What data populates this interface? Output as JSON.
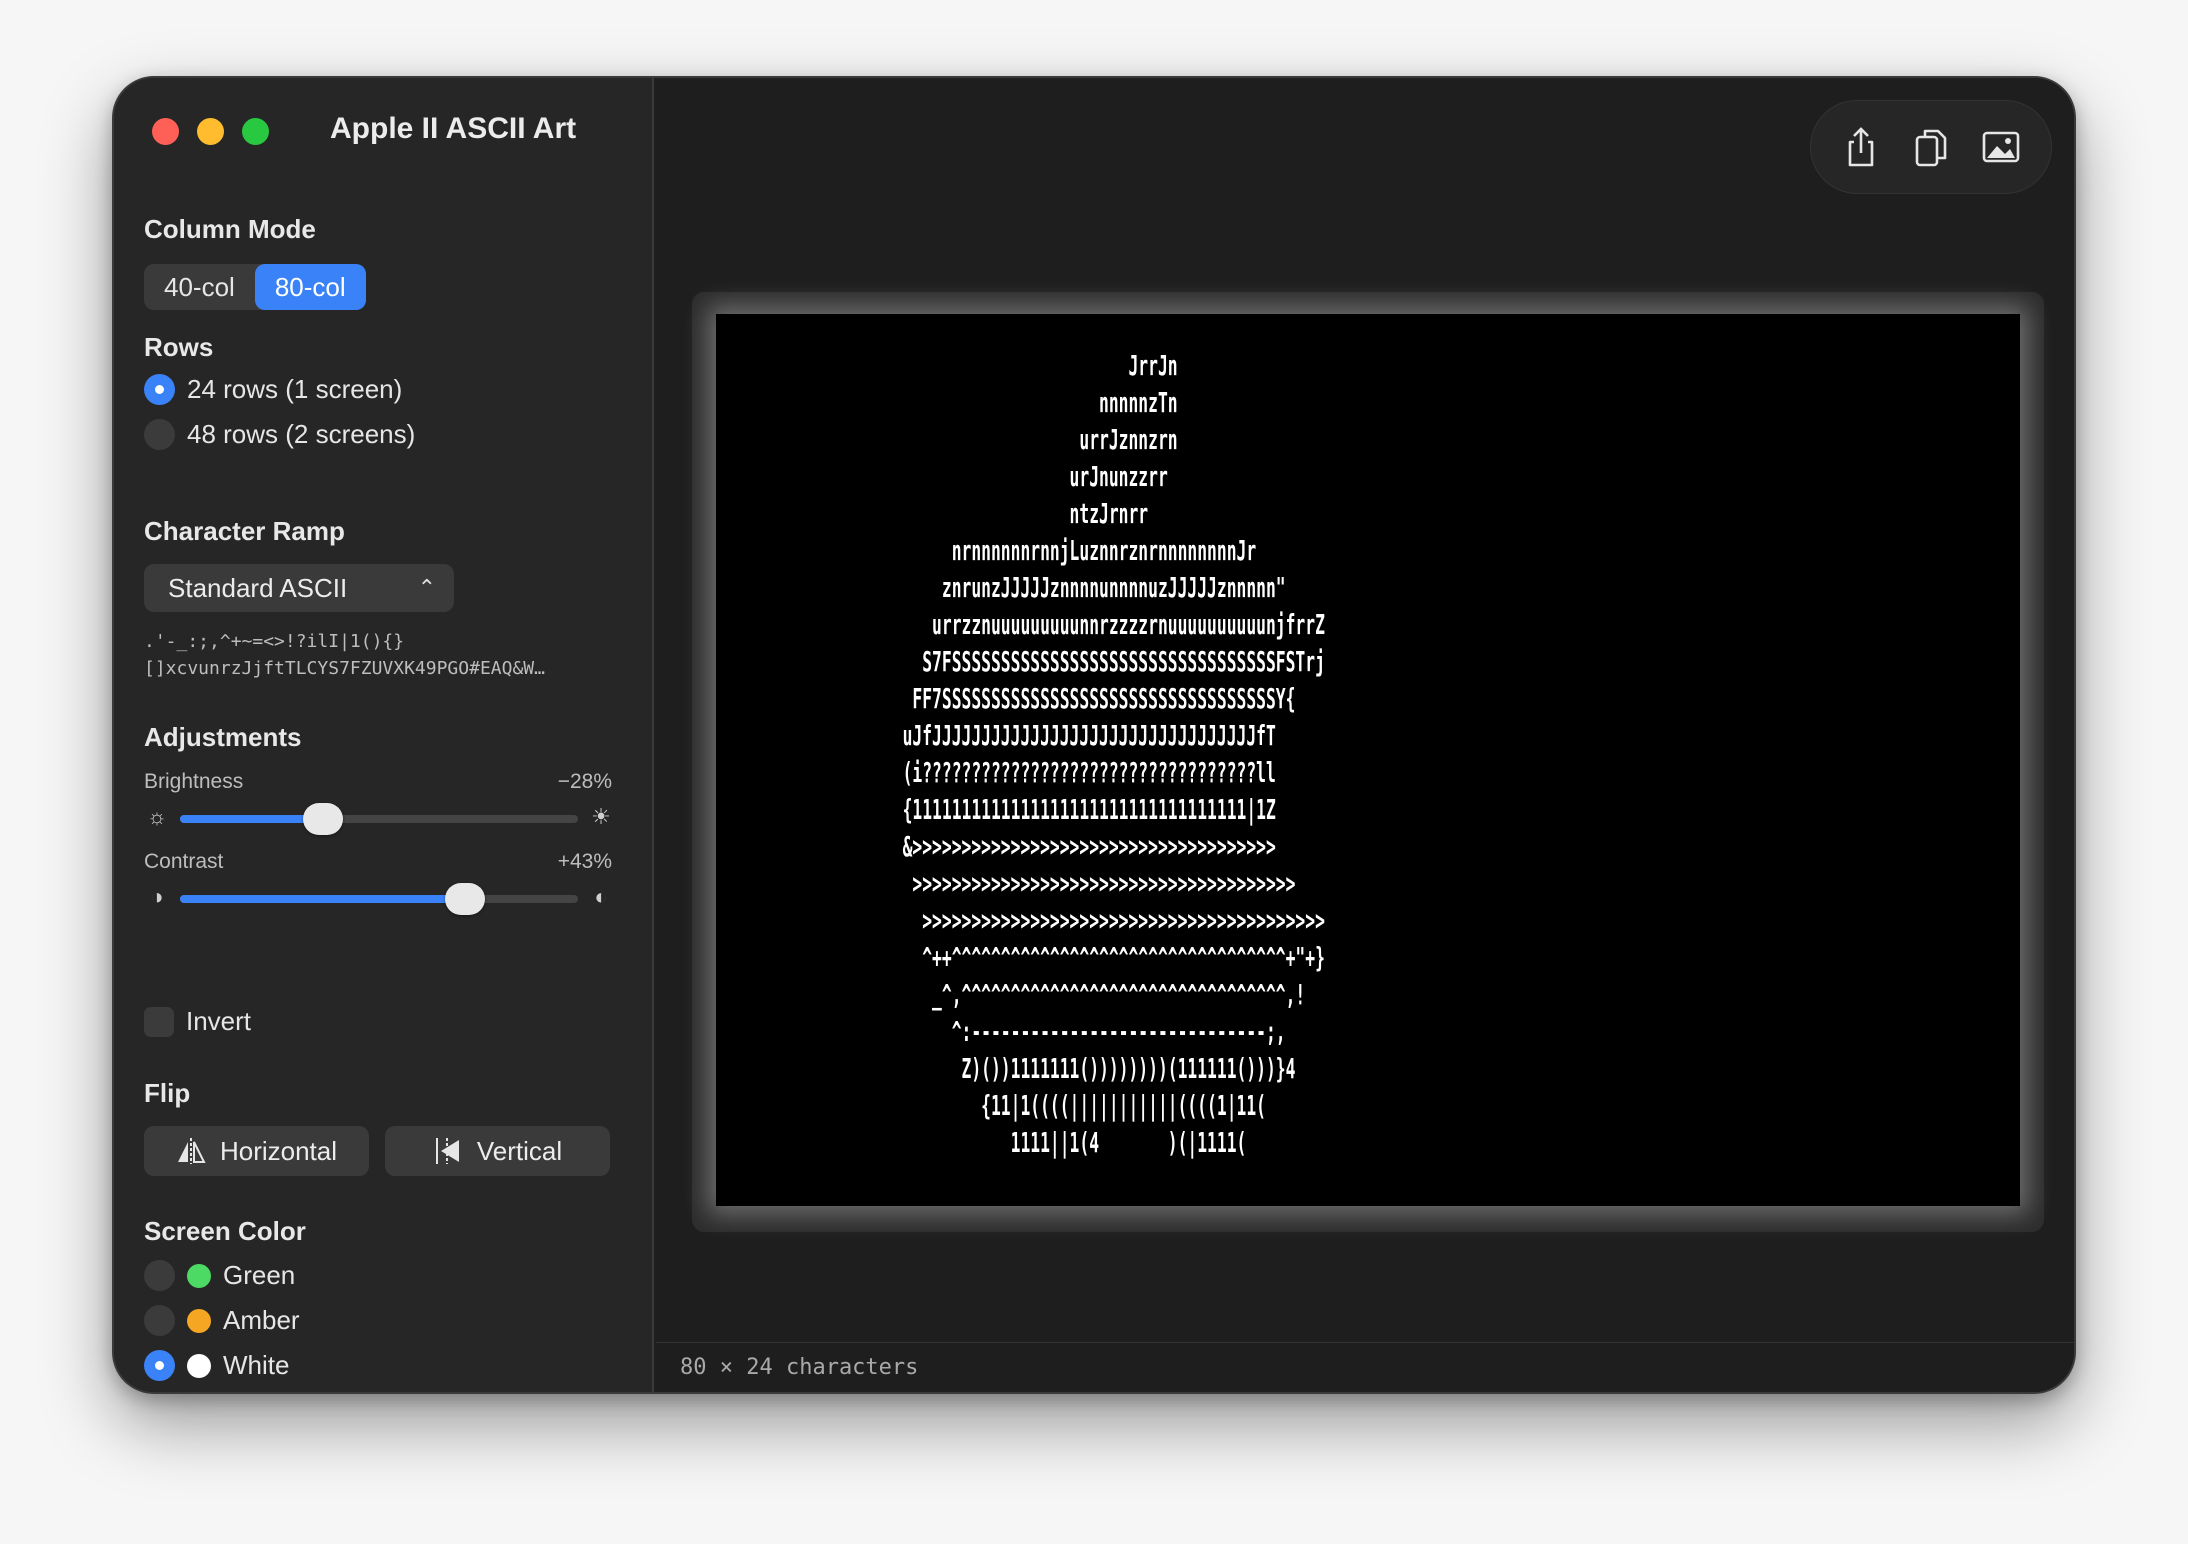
{
  "app": {
    "title": "Apple II ASCII Art"
  },
  "column_mode": {
    "title": "Column Mode",
    "options": [
      "40-col",
      "80-col"
    ],
    "selected": "80-col"
  },
  "rows": {
    "title": "Rows",
    "options": [
      "24 rows (1 screen)",
      "48 rows (2 screens)"
    ],
    "selected": "24 rows (1 screen)"
  },
  "character_ramp": {
    "title": "Character Ramp",
    "selected": "Standard ASCII",
    "preview_line1": " .'-_:;,^+~=<>!?ilI|1(){}",
    "preview_line2": "[]xcvunrzJjftTLCYS7FZUVXK49PGO#EAQ&W…"
  },
  "adjustments": {
    "title": "Adjustments",
    "brightness": {
      "label": "Brightness",
      "value_text": "−28%",
      "fraction": 0.36
    },
    "contrast": {
      "label": "Contrast",
      "value_text": "+43%",
      "fraction": 0.715
    },
    "invert": {
      "label": "Invert",
      "checked": false
    }
  },
  "flip": {
    "title": "Flip",
    "horizontal_label": "Horizontal",
    "vertical_label": "Vertical"
  },
  "screen_color": {
    "title": "Screen Color",
    "options": [
      {
        "label": "Green",
        "color": "#4cd964"
      },
      {
        "label": "Amber",
        "color": "#f5a623"
      },
      {
        "label": "White",
        "color": "#ffffff"
      }
    ],
    "selected": "White"
  },
  "toolbar": {
    "icons": [
      "share-icon",
      "copy-icon",
      "image-icon"
    ]
  },
  "preview": {
    "lines": [
      "                                          JrrJn",
      "                                       nnnnnzTn",
      "                                     urrJznnzrn",
      "                                    urJnunzzrr",
      "                                    ntzJrnrr",
      "                        nrnnnnnnrnnjLuznnrznrnnnnnnnnJr",
      "                       znrunzJJJJJznnnnunnnnuzJJJJJznnnnn\"",
      "                      urrzznuuuuuuuuunnrzzzzrnuuuuuuuuuunjfrrZ",
      "                     S7FSSSSSSSSSSSSSSSSSSSSSSSSSSSSSSSSSFSTrj",
      "                    FF7SSSSSSSSSSSSSSSSSSSSSSSSSSSSSSSSSSY{",
      "                   uJfJJJJJJJJJJJJJJJJJJJJJJJJJJJJJJJJJfT",
      "                   (i??????????????????????????????????ll",
      "                   {1111111111111111111111111111111111|1Z",
      "                   &>>>>>>>>>>>>>>>>>>>>>>>>>>>>>>>>>>>>>",
      "                    >>>>>>>>>>>>>>>>>>>>>>>>>>>>>>>>>>>>>>>",
      "                     >>>>>>>>>>>>>>>>>>>>>>>>>>>>>>>>>>>>>>>>>",
      "                     ^++^^^^^^^^^^^^^^^^^^^^^^^^^^^^^^^^^^+\"+}",
      "                      _^,^^^^^^^^^^^^^^^^^^^^^^^^^^^^^^^^^,!",
      "                        ^:------------------------------;,",
      "                         Z)())1111111())))))))(111111()))}4",
      "                           {11|1((((|||||||||||((((1|11(",
      "                              1111||1(4       )(|1111(",
      "",
      ""
    ]
  },
  "status": {
    "text": "80 × 24 characters"
  }
}
